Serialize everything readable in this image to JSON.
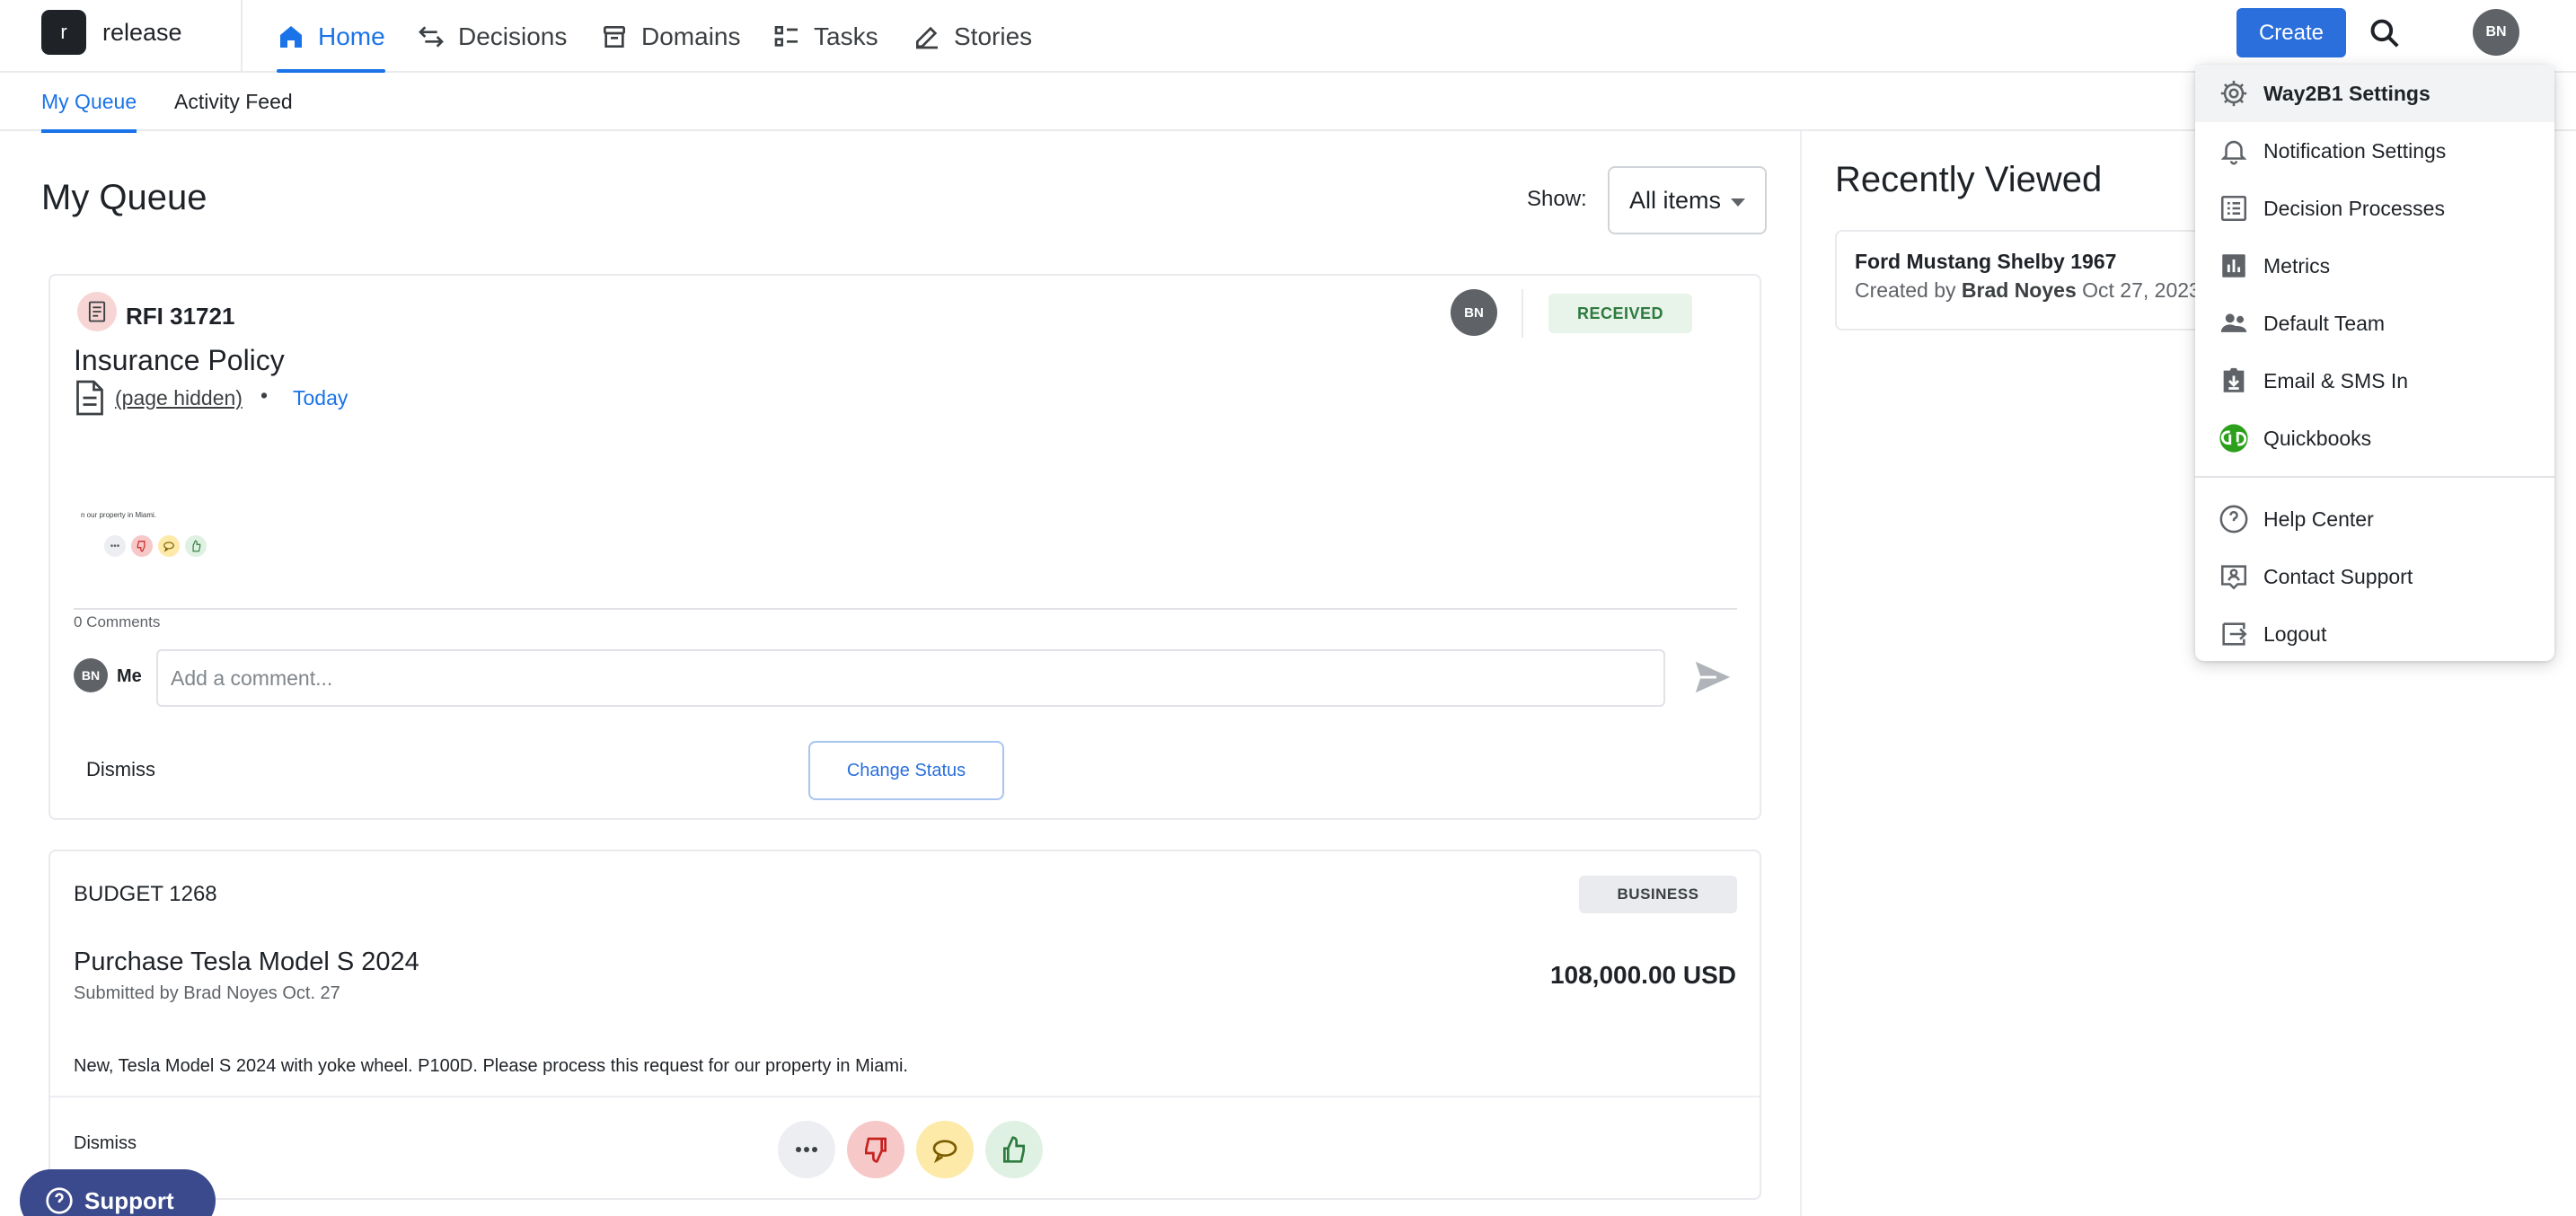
{
  "app": {
    "logo_letter": "r",
    "name": "release"
  },
  "nav": {
    "items": [
      {
        "label": "Home",
        "icon": "home-icon",
        "active": true
      },
      {
        "label": "Decisions",
        "icon": "arrows-icon"
      },
      {
        "label": "Domains",
        "icon": "box-icon"
      },
      {
        "label": "Tasks",
        "icon": "checklist-icon"
      },
      {
        "label": "Stories",
        "icon": "pencil-icon"
      }
    ],
    "create_label": "Create",
    "user_initials": "BN"
  },
  "subtabs": [
    {
      "label": "My Queue",
      "active": true
    },
    {
      "label": "Activity Feed"
    }
  ],
  "queue": {
    "title": "My Queue",
    "show_label": "Show:",
    "show_value": "All items"
  },
  "rfi_card": {
    "id": "RFI 31721",
    "avatar": "BN",
    "status": "RECEIVED",
    "title": "Insurance Policy",
    "page_link": "(page hidden)",
    "separator": "•",
    "date": "Today",
    "preview_text": "n our property in Miami.",
    "comments_count": "0 Comments",
    "me_initials": "BN",
    "me_label": "Me",
    "comment_placeholder": "Add a comment...",
    "dismiss_label": "Dismiss",
    "change_status_label": "Change Status"
  },
  "budget_card": {
    "id": "BUDGET 1268",
    "category": "BUSINESS",
    "title": "Purchase Tesla Model S 2024",
    "submitted": "Submitted by Brad Noyes Oct. 27",
    "amount": "108,000.00 USD",
    "description": "New, Tesla Model S 2024 with yoke wheel. P100D. Please process this request for our property in Miami.",
    "dismiss_label": "Dismiss"
  },
  "support": {
    "label": "Support"
  },
  "recently_viewed": {
    "title": "Recently Viewed",
    "item_name": "Ford Mustang Shelby 1967",
    "created_prefix": "Created by",
    "created_by": "Brad Noyes",
    "created_date": "Oct 27, 2023"
  },
  "menu": {
    "items": [
      {
        "label": "Way2B1 Settings",
        "icon": "gear-icon"
      },
      {
        "label": "Notification Settings",
        "icon": "bell-icon"
      },
      {
        "label": "Decision Processes",
        "icon": "list-icon"
      },
      {
        "label": "Metrics",
        "icon": "bar-chart-icon"
      },
      {
        "label": "Default Team",
        "icon": "team-icon"
      },
      {
        "label": "Email & SMS In",
        "icon": "inbox-download-icon"
      },
      {
        "label": "Quickbooks",
        "icon": "quickbooks-icon"
      },
      {
        "label": "Help Center",
        "icon": "help-icon"
      },
      {
        "label": "Contact Support",
        "icon": "contact-support-icon"
      },
      {
        "label": "Logout",
        "icon": "logout-icon"
      }
    ]
  },
  "colors": {
    "accent": "#1a73e8",
    "primary_button": "#2b6fdd",
    "support": "#3b4a8c",
    "received_bg": "#e8f3ea",
    "received_text": "#2d7a3e"
  }
}
